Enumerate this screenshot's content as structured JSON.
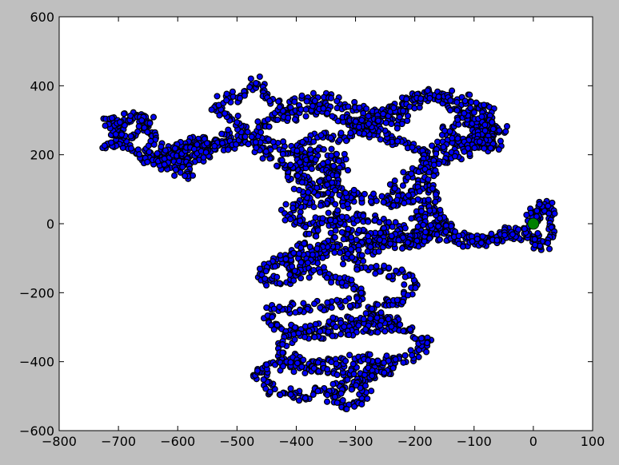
{
  "figure": {
    "background_color": "#bfbfbf",
    "axes_background_color": "#ffffff"
  },
  "chart_data": {
    "type": "scatter",
    "title": "",
    "xlabel": "",
    "ylabel": "",
    "xlim": [
      -800,
      100
    ],
    "ylim": [
      -600,
      600
    ],
    "x_ticks": [
      -800,
      -700,
      -600,
      -500,
      -400,
      -300,
      -200,
      -100,
      0,
      100
    ],
    "x_tick_labels": [
      "−800",
      "−700",
      "−600",
      "−500",
      "−400",
      "−300",
      "−200",
      "−100",
      "0",
      "100"
    ],
    "y_ticks": [
      -600,
      -400,
      -200,
      0,
      200,
      400,
      600
    ],
    "y_tick_labels": [
      "−600",
      "−400",
      "−200",
      "0",
      "200",
      "400",
      "600"
    ],
    "grid": false,
    "legend": "none",
    "series": [
      {
        "marker": "circle",
        "fill_color": "#0000ff",
        "edge_color": "#000000",
        "path_anchors": [
          [
            0,
            0
          ],
          [
            20,
            50
          ],
          [
            25,
            60
          ],
          [
            30,
            -10
          ],
          [
            20,
            -70
          ],
          [
            -10,
            -40
          ],
          [
            -40,
            -20
          ],
          [
            -80,
            -50
          ],
          [
            -130,
            -40
          ],
          [
            -180,
            -30
          ],
          [
            -210,
            -50
          ],
          [
            -220,
            -60
          ],
          [
            -200,
            -50
          ],
          [
            -170,
            -10
          ],
          [
            -150,
            0
          ],
          [
            -140,
            -20
          ],
          [
            -160,
            20
          ],
          [
            -200,
            60
          ],
          [
            -240,
            90
          ],
          [
            -220,
            120
          ],
          [
            -190,
            180
          ],
          [
            -170,
            200
          ],
          [
            -190,
            210
          ],
          [
            -230,
            240
          ],
          [
            -270,
            260
          ],
          [
            -300,
            280
          ],
          [
            -320,
            300
          ],
          [
            -290,
            280
          ],
          [
            -250,
            320
          ],
          [
            -210,
            360
          ],
          [
            -170,
            370
          ],
          [
            -140,
            350
          ],
          [
            -110,
            310
          ],
          [
            -100,
            270
          ],
          [
            -80,
            270
          ],
          [
            -50,
            270
          ],
          [
            -80,
            250
          ],
          [
            -130,
            240
          ],
          [
            -150,
            220
          ],
          [
            -160,
            230
          ],
          [
            -170,
            200
          ],
          [
            -180,
            180
          ],
          [
            -190,
            130
          ],
          [
            -200,
            80
          ],
          [
            -230,
            60
          ],
          [
            -260,
            70
          ],
          [
            -300,
            80
          ],
          [
            -340,
            70
          ],
          [
            -380,
            60
          ],
          [
            -420,
            40
          ],
          [
            -410,
            10
          ],
          [
            -360,
            0
          ],
          [
            -300,
            20
          ],
          [
            -250,
            0
          ],
          [
            -220,
            -20
          ],
          [
            -250,
            -40
          ],
          [
            -300,
            -60
          ],
          [
            -350,
            -80
          ],
          [
            -400,
            -100
          ],
          [
            -440,
            -120
          ],
          [
            -460,
            -150
          ],
          [
            -440,
            -170
          ],
          [
            -400,
            -150
          ],
          [
            -360,
            -130
          ],
          [
            -330,
            -160
          ],
          [
            -300,
            -180
          ],
          [
            -290,
            -220
          ],
          [
            -320,
            -230
          ],
          [
            -380,
            -240
          ],
          [
            -440,
            -250
          ],
          [
            -450,
            -280
          ],
          [
            -420,
            -300
          ],
          [
            -380,
            -310
          ],
          [
            -340,
            -290
          ],
          [
            -290,
            -280
          ],
          [
            -250,
            -270
          ],
          [
            -230,
            -290
          ],
          [
            -260,
            -300
          ],
          [
            -310,
            -310
          ],
          [
            -370,
            -320
          ],
          [
            -420,
            -340
          ],
          [
            -430,
            -380
          ],
          [
            -400,
            -400
          ],
          [
            -350,
            -420
          ],
          [
            -300,
            -430
          ],
          [
            -260,
            -410
          ],
          [
            -240,
            -430
          ],
          [
            -280,
            -450
          ],
          [
            -320,
            -470
          ],
          [
            -340,
            -500
          ],
          [
            -320,
            -530
          ],
          [
            -290,
            -520
          ],
          [
            -280,
            -490
          ],
          [
            -300,
            -470
          ],
          [
            -350,
            -480
          ],
          [
            -400,
            -500
          ],
          [
            -440,
            -480
          ],
          [
            -470,
            -430
          ],
          [
            -430,
            -410
          ],
          [
            -380,
            -420
          ],
          [
            -330,
            -400
          ],
          [
            -280,
            -390
          ],
          [
            -240,
            -400
          ],
          [
            -200,
            -380
          ],
          [
            -180,
            -350
          ],
          [
            -200,
            -320
          ],
          [
            -240,
            -300
          ],
          [
            -280,
            -270
          ],
          [
            -260,
            -240
          ],
          [
            -220,
            -220
          ],
          [
            -200,
            -180
          ],
          [
            -220,
            -150
          ],
          [
            -260,
            -130
          ],
          [
            -300,
            -120
          ],
          [
            -320,
            -100
          ],
          [
            -290,
            -80
          ],
          [
            -250,
            -60
          ],
          [
            -220,
            -40
          ],
          [
            -180,
            -30
          ],
          [
            -200,
            -50
          ],
          [
            -260,
            -40
          ],
          [
            -320,
            -30
          ],
          [
            -360,
            -60
          ],
          [
            -380,
            -110
          ],
          [
            -400,
            -150
          ],
          [
            -420,
            -100
          ],
          [
            -380,
            -50
          ],
          [
            -350,
            0
          ],
          [
            -320,
            50
          ],
          [
            -310,
            90
          ],
          [
            -340,
            110
          ],
          [
            -380,
            120
          ],
          [
            -400,
            150
          ],
          [
            -390,
            190
          ],
          [
            -360,
            210
          ],
          [
            -330,
            200
          ],
          [
            -320,
            170
          ],
          [
            -340,
            150
          ],
          [
            -370,
            170
          ],
          [
            -400,
            210
          ],
          [
            -420,
            220
          ],
          [
            -450,
            230
          ],
          [
            -470,
            260
          ],
          [
            -450,
            300
          ],
          [
            -420,
            320
          ],
          [
            -400,
            350
          ],
          [
            -380,
            370
          ],
          [
            -350,
            360
          ],
          [
            -310,
            340
          ],
          [
            -270,
            320
          ],
          [
            -240,
            330
          ],
          [
            -220,
            300
          ],
          [
            -260,
            280
          ],
          [
            -300,
            260
          ],
          [
            -340,
            250
          ],
          [
            -380,
            240
          ],
          [
            -400,
            210
          ],
          [
            -380,
            180
          ],
          [
            -350,
            170
          ],
          [
            -330,
            130
          ],
          [
            -350,
            100
          ],
          [
            -380,
            90
          ],
          [
            -400,
            120
          ],
          [
            -420,
            170
          ],
          [
            -440,
            200
          ],
          [
            -470,
            220
          ],
          [
            -500,
            240
          ],
          [
            -520,
            260
          ],
          [
            -540,
            240
          ],
          [
            -570,
            230
          ],
          [
            -600,
            220
          ],
          [
            -620,
            200
          ],
          [
            -640,
            190
          ],
          [
            -660,
            200
          ],
          [
            -680,
            230
          ],
          [
            -700,
            240
          ],
          [
            -720,
            220
          ],
          [
            -710,
            260
          ],
          [
            -690,
            290
          ],
          [
            -670,
            310
          ],
          [
            -650,
            300
          ],
          [
            -660,
            270
          ],
          [
            -680,
            250
          ],
          [
            -700,
            270
          ],
          [
            -720,
            290
          ],
          [
            -700,
            300
          ],
          [
            -670,
            320
          ],
          [
            -650,
            280
          ],
          [
            -640,
            230
          ],
          [
            -620,
            210
          ],
          [
            -600,
            190
          ],
          [
            -580,
            180
          ],
          [
            -560,
            200
          ],
          [
            -540,
            220
          ],
          [
            -570,
            240
          ],
          [
            -600,
            230
          ],
          [
            -590,
            170
          ],
          [
            -580,
            140
          ],
          [
            -600,
            150
          ],
          [
            -620,
            170
          ],
          [
            -640,
            180
          ],
          [
            -660,
            190
          ],
          [
            -620,
            200
          ],
          [
            -580,
            210
          ],
          [
            -540,
            220
          ],
          [
            -500,
            230
          ],
          [
            -480,
            260
          ],
          [
            -500,
            290
          ],
          [
            -520,
            320
          ],
          [
            -540,
            340
          ],
          [
            -520,
            360
          ],
          [
            -500,
            370
          ],
          [
            -480,
            390
          ],
          [
            -470,
            410
          ],
          [
            -460,
            400
          ],
          [
            -450,
            370
          ],
          [
            -430,
            340
          ],
          [
            -410,
            310
          ],
          [
            -390,
            320
          ],
          [
            -370,
            340
          ],
          [
            -350,
            320
          ],
          [
            -320,
            300
          ],
          [
            -290,
            290
          ],
          [
            -260,
            310
          ],
          [
            -230,
            330
          ],
          [
            -200,
            350
          ],
          [
            -180,
            380
          ],
          [
            -160,
            370
          ],
          [
            -130,
            370
          ],
          [
            -110,
            360
          ],
          [
            -90,
            340
          ],
          [
            -70,
            320
          ],
          [
            -90,
            290
          ],
          [
            -100,
            260
          ],
          [
            -80,
            240
          ],
          [
            -60,
            240
          ],
          [
            -70,
            220
          ],
          [
            -100,
            230
          ],
          [
            -130,
            250
          ],
          [
            -150,
            270
          ],
          [
            -130,
            300
          ],
          [
            -100,
            320
          ],
          [
            -80,
            300
          ],
          [
            -70,
            270
          ],
          [
            -100,
            220
          ],
          [
            -140,
            190
          ],
          [
            -170,
            160
          ],
          [
            -180,
            120
          ],
          [
            -160,
            80
          ],
          [
            -180,
            40
          ],
          [
            -200,
            20
          ],
          [
            -180,
            -10
          ],
          [
            -150,
            -30
          ],
          [
            -120,
            -50
          ],
          [
            -90,
            -50
          ],
          [
            -60,
            -40
          ],
          [
            -40,
            -30
          ],
          [
            -20,
            -20
          ],
          [
            0,
            -40
          ],
          [
            10,
            -60
          ],
          [
            -10,
            -20
          ],
          [
            0,
            30
          ],
          [
            10,
            50
          ],
          [
            -5,
            10
          ]
        ]
      },
      {
        "name": "",
        "marker": "circle",
        "fill_color": "#008000",
        "edge_color": "#000000",
        "x": [
          0
        ],
        "y": [
          0
        ]
      }
    ]
  }
}
